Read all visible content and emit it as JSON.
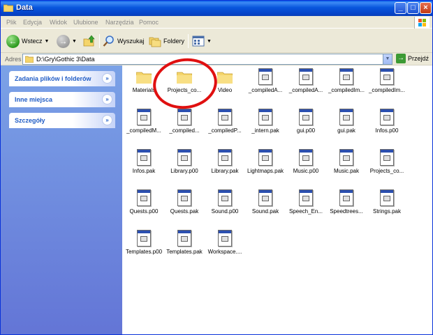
{
  "window": {
    "title": "Data",
    "minimize": "_",
    "maximize": "□",
    "close": "×"
  },
  "menu": [
    "Plik",
    "Edycja",
    "Widok",
    "Ulubione",
    "Narzędzia",
    "Pomoc"
  ],
  "toolbar": {
    "back_label": "Wstecz",
    "search_label": "Wyszukaj",
    "folders_label": "Foldery"
  },
  "address": {
    "label": "Adres",
    "value": "D:\\Gry\\Gothic 3\\Data",
    "go_label": "Przejdź"
  },
  "sidebar": {
    "panels": [
      "Zadania plików i folderów",
      "Inne miejsca",
      "Szczegóły"
    ],
    "chevron": "»"
  },
  "files": [
    {
      "name": "Materials",
      "icon": "folder-icon"
    },
    {
      "name": "Projects_co...",
      "icon": "folder-icon"
    },
    {
      "name": "Video",
      "icon": "folder-icon"
    },
    {
      "name": "_compiledA...",
      "icon": "pak-file-icon"
    },
    {
      "name": "_compiledA...",
      "icon": "pak-file-icon"
    },
    {
      "name": "_compiledIm...",
      "icon": "pak-file-icon"
    },
    {
      "name": "_compiledIm...",
      "icon": "pak-file-icon"
    },
    {
      "name": "_compiledM...",
      "icon": "pak-file-icon"
    },
    {
      "name": "_compiled...",
      "icon": "pak-file-icon"
    },
    {
      "name": "_compiledP...",
      "icon": "pak-file-icon"
    },
    {
      "name": "_intern.pak",
      "icon": "pak-file-icon"
    },
    {
      "name": "gui.p00",
      "icon": "pak-file-icon"
    },
    {
      "name": "gui.pak",
      "icon": "pak-file-icon"
    },
    {
      "name": "Infos.p00",
      "icon": "pak-file-icon"
    },
    {
      "name": "Infos.pak",
      "icon": "pak-file-icon"
    },
    {
      "name": "Library.p00",
      "icon": "pak-file-icon"
    },
    {
      "name": "Library.pak",
      "icon": "pak-file-icon"
    },
    {
      "name": "Lightmaps.pak",
      "icon": "pak-file-icon"
    },
    {
      "name": "Music.p00",
      "icon": "pak-file-icon"
    },
    {
      "name": "Music.pak",
      "icon": "pak-file-icon"
    },
    {
      "name": "Projects_co...",
      "icon": "pak-file-icon"
    },
    {
      "name": "Quests.p00",
      "icon": "pak-file-icon"
    },
    {
      "name": "Quests.pak",
      "icon": "pak-file-icon"
    },
    {
      "name": "Sound.p00",
      "icon": "pak-file-icon"
    },
    {
      "name": "Sound.pak",
      "icon": "pak-file-icon"
    },
    {
      "name": "Speech_En...",
      "icon": "pak-file-icon"
    },
    {
      "name": "Speedtrees...",
      "icon": "pak-file-icon"
    },
    {
      "name": "Strings.pak",
      "icon": "pak-file-icon"
    },
    {
      "name": "Templates.p00",
      "icon": "pak-file-icon"
    },
    {
      "name": "Templates.pak",
      "icon": "pak-file-icon"
    },
    {
      "name": "Workspace....",
      "icon": "pak-file-icon"
    }
  ],
  "annotation": {
    "shape": "red-circle-annotation",
    "color": "#e01010",
    "highlighted_item": "Projects_co..."
  },
  "colors": {
    "titlebar": "#0855dd",
    "sidebar": "#7ba2e7",
    "panel_title": "#215dc6"
  }
}
